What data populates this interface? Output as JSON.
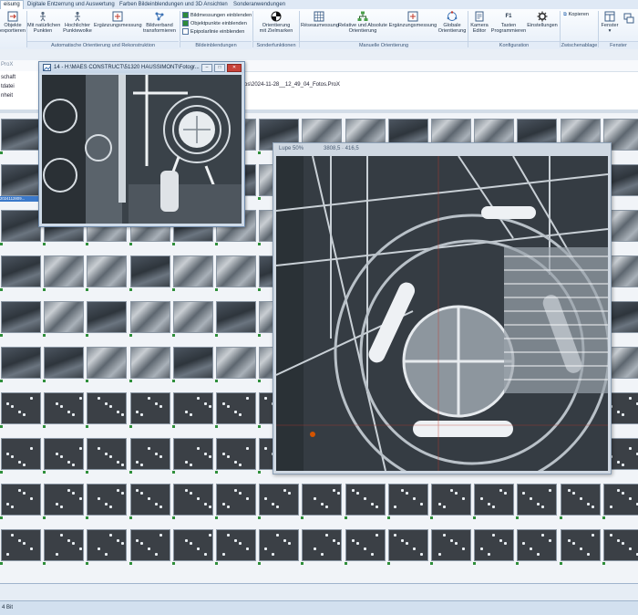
{
  "ribbon": {
    "tabs": [
      {
        "label": "eisung",
        "active": true
      },
      {
        "label": "Digitale Entzerrung und Auswertung",
        "active": false
      },
      {
        "label": "Farben Bildeinblendungen und 3D Ansichten",
        "active": false
      },
      {
        "label": "Sonderanwendungen",
        "active": false
      }
    ],
    "buttons": {
      "objekte_exportieren": "Objekte\nexportieren",
      "mit_natuerlichen_punkten": "Mit natürlichen\nPunkten",
      "hochlichter_punktewolke": "Hochlichter\nPunktewolke",
      "ergaenzungsmessung": "Ergänzungsmessung",
      "bildverband_transformieren": "Bildverband\ntransformieren",
      "orientierung_mit_zielmarken": "Orientierung\nmit Zielmarken",
      "reseaumessung": "Réseaumessung",
      "relative_absolute_orientierung": "Relative und Absolute\nOrientierung",
      "ergaenzungsmessung_2": "Ergänzungsmessung",
      "globale_orientierung": "Globale\nOrientierung",
      "kamera_editor": "Kamera\nEditor",
      "tasten_programmieren": "Tasten\nProgrammieren",
      "einstellungen": "Einstellungen",
      "kopieren": "Kopieren",
      "fenster": "Fenster"
    },
    "f1_label": "F1",
    "checkboxes": [
      {
        "label": "Bildmessungen einblenden",
        "checked": true
      },
      {
        "label": "Objektpunkte einblenden",
        "checked": true
      },
      {
        "label": "Epipolarlinie einblenden",
        "checked": false
      }
    ],
    "groups": [
      "Automatische Orientierung und Rekonstruktion",
      "Bildeinblendungen",
      "Sonderfunktionen",
      "Manuelle Orientierung",
      "Konfiguration",
      "Zwischenablage",
      "Fenster"
    ]
  },
  "sidebar": {
    "items": [
      "schaft",
      "tdatei",
      "nheit"
    ],
    "header": "ProX"
  },
  "project_path": "os\\2024-11-28__12_49_04_Fotos.ProX",
  "image_window": {
    "title": "14 - H:\\MAES CONSTRUCT\\51320 HAUSSIMONT\\Fotogr...",
    "min": "–",
    "max": "□",
    "close": "✕"
  },
  "loupe": {
    "title": "Lupe 50%",
    "coords": "3808,5 · 416,5"
  },
  "thumbnails": {
    "selected_caption": "2024112809..."
  },
  "status": {
    "text": "4 Bit"
  }
}
